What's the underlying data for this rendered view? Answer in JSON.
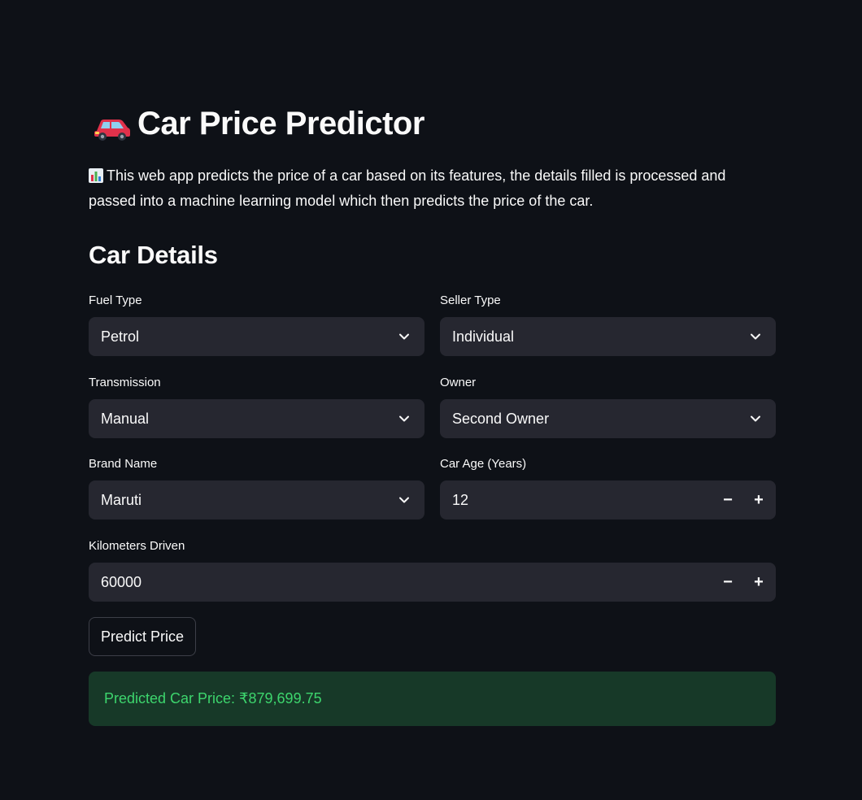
{
  "header": {
    "title": "Car Price Predictor",
    "title_icon": "car-icon",
    "intro_icon": "bar-chart-icon",
    "intro": "This web app predicts the price of a car based on its features, the details filled is processed and passed into a machine learning model which then predicts the price of the car."
  },
  "form": {
    "section_title": "Car Details",
    "fuel_type": {
      "label": "Fuel Type",
      "value": "Petrol"
    },
    "seller_type": {
      "label": "Seller Type",
      "value": "Individual"
    },
    "transmission": {
      "label": "Transmission",
      "value": "Manual"
    },
    "owner": {
      "label": "Owner",
      "value": "Second Owner"
    },
    "brand_name": {
      "label": "Brand Name",
      "value": "Maruti"
    },
    "car_age": {
      "label": "Car Age (Years)",
      "value": "12",
      "minus": "−",
      "plus": "+"
    },
    "kilometers": {
      "label": "Kilometers Driven",
      "value": "60000",
      "minus": "−",
      "plus": "+"
    },
    "predict_label": "Predict Price"
  },
  "result": {
    "text": "Predicted Car Price: ₹879,699.75"
  },
  "colors": {
    "background": "#0e1117",
    "input_bg": "#262730",
    "success_bg": "#173928",
    "success_text": "#3dd56d"
  }
}
